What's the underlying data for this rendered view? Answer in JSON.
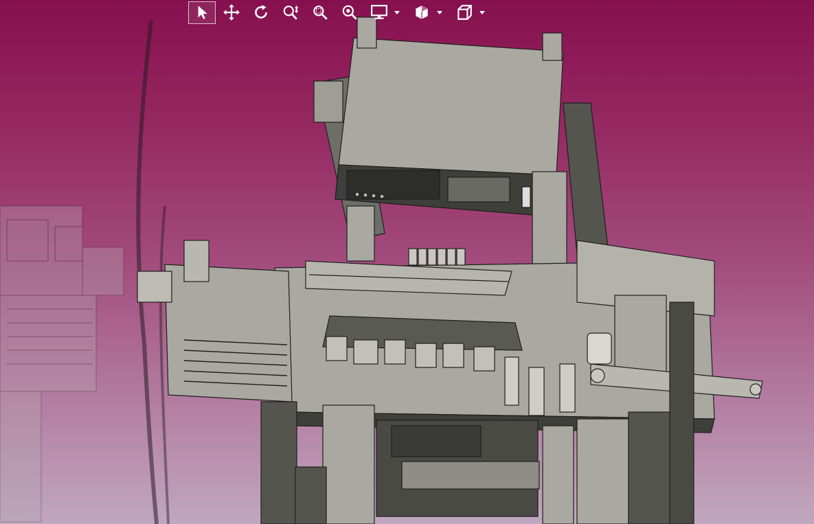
{
  "app": {
    "window_title": "",
    "background_top": "#86104f",
    "background_bottom": "#c1a7c0"
  },
  "toolbar": {
    "tools": [
      {
        "id": "select",
        "icon": "select-arrow-icon",
        "active": true
      },
      {
        "id": "pan",
        "icon": "pan-move-icon",
        "active": false
      },
      {
        "id": "rotate",
        "icon": "rotate-icon",
        "active": false
      },
      {
        "id": "zoom",
        "icon": "zoom-icon",
        "active": false
      },
      {
        "id": "zoom-window",
        "icon": "zoom-window-icon",
        "active": false
      },
      {
        "id": "zoom-fit",
        "icon": "zoom-fit-icon",
        "active": false
      },
      {
        "id": "display-mode",
        "icon": "display-monitor-icon",
        "has_dropdown": true
      },
      {
        "id": "section-view",
        "icon": "section-view-icon",
        "has_dropdown": true
      },
      {
        "id": "view-orientation",
        "icon": "view-cube-icon",
        "has_dropdown": true
      }
    ],
    "icon_color": "#ffffff"
  },
  "scene": {
    "model": "cad-machine-assembly",
    "shading_color": "#a9a8a1",
    "edge_color": "#1e1e1e"
  }
}
